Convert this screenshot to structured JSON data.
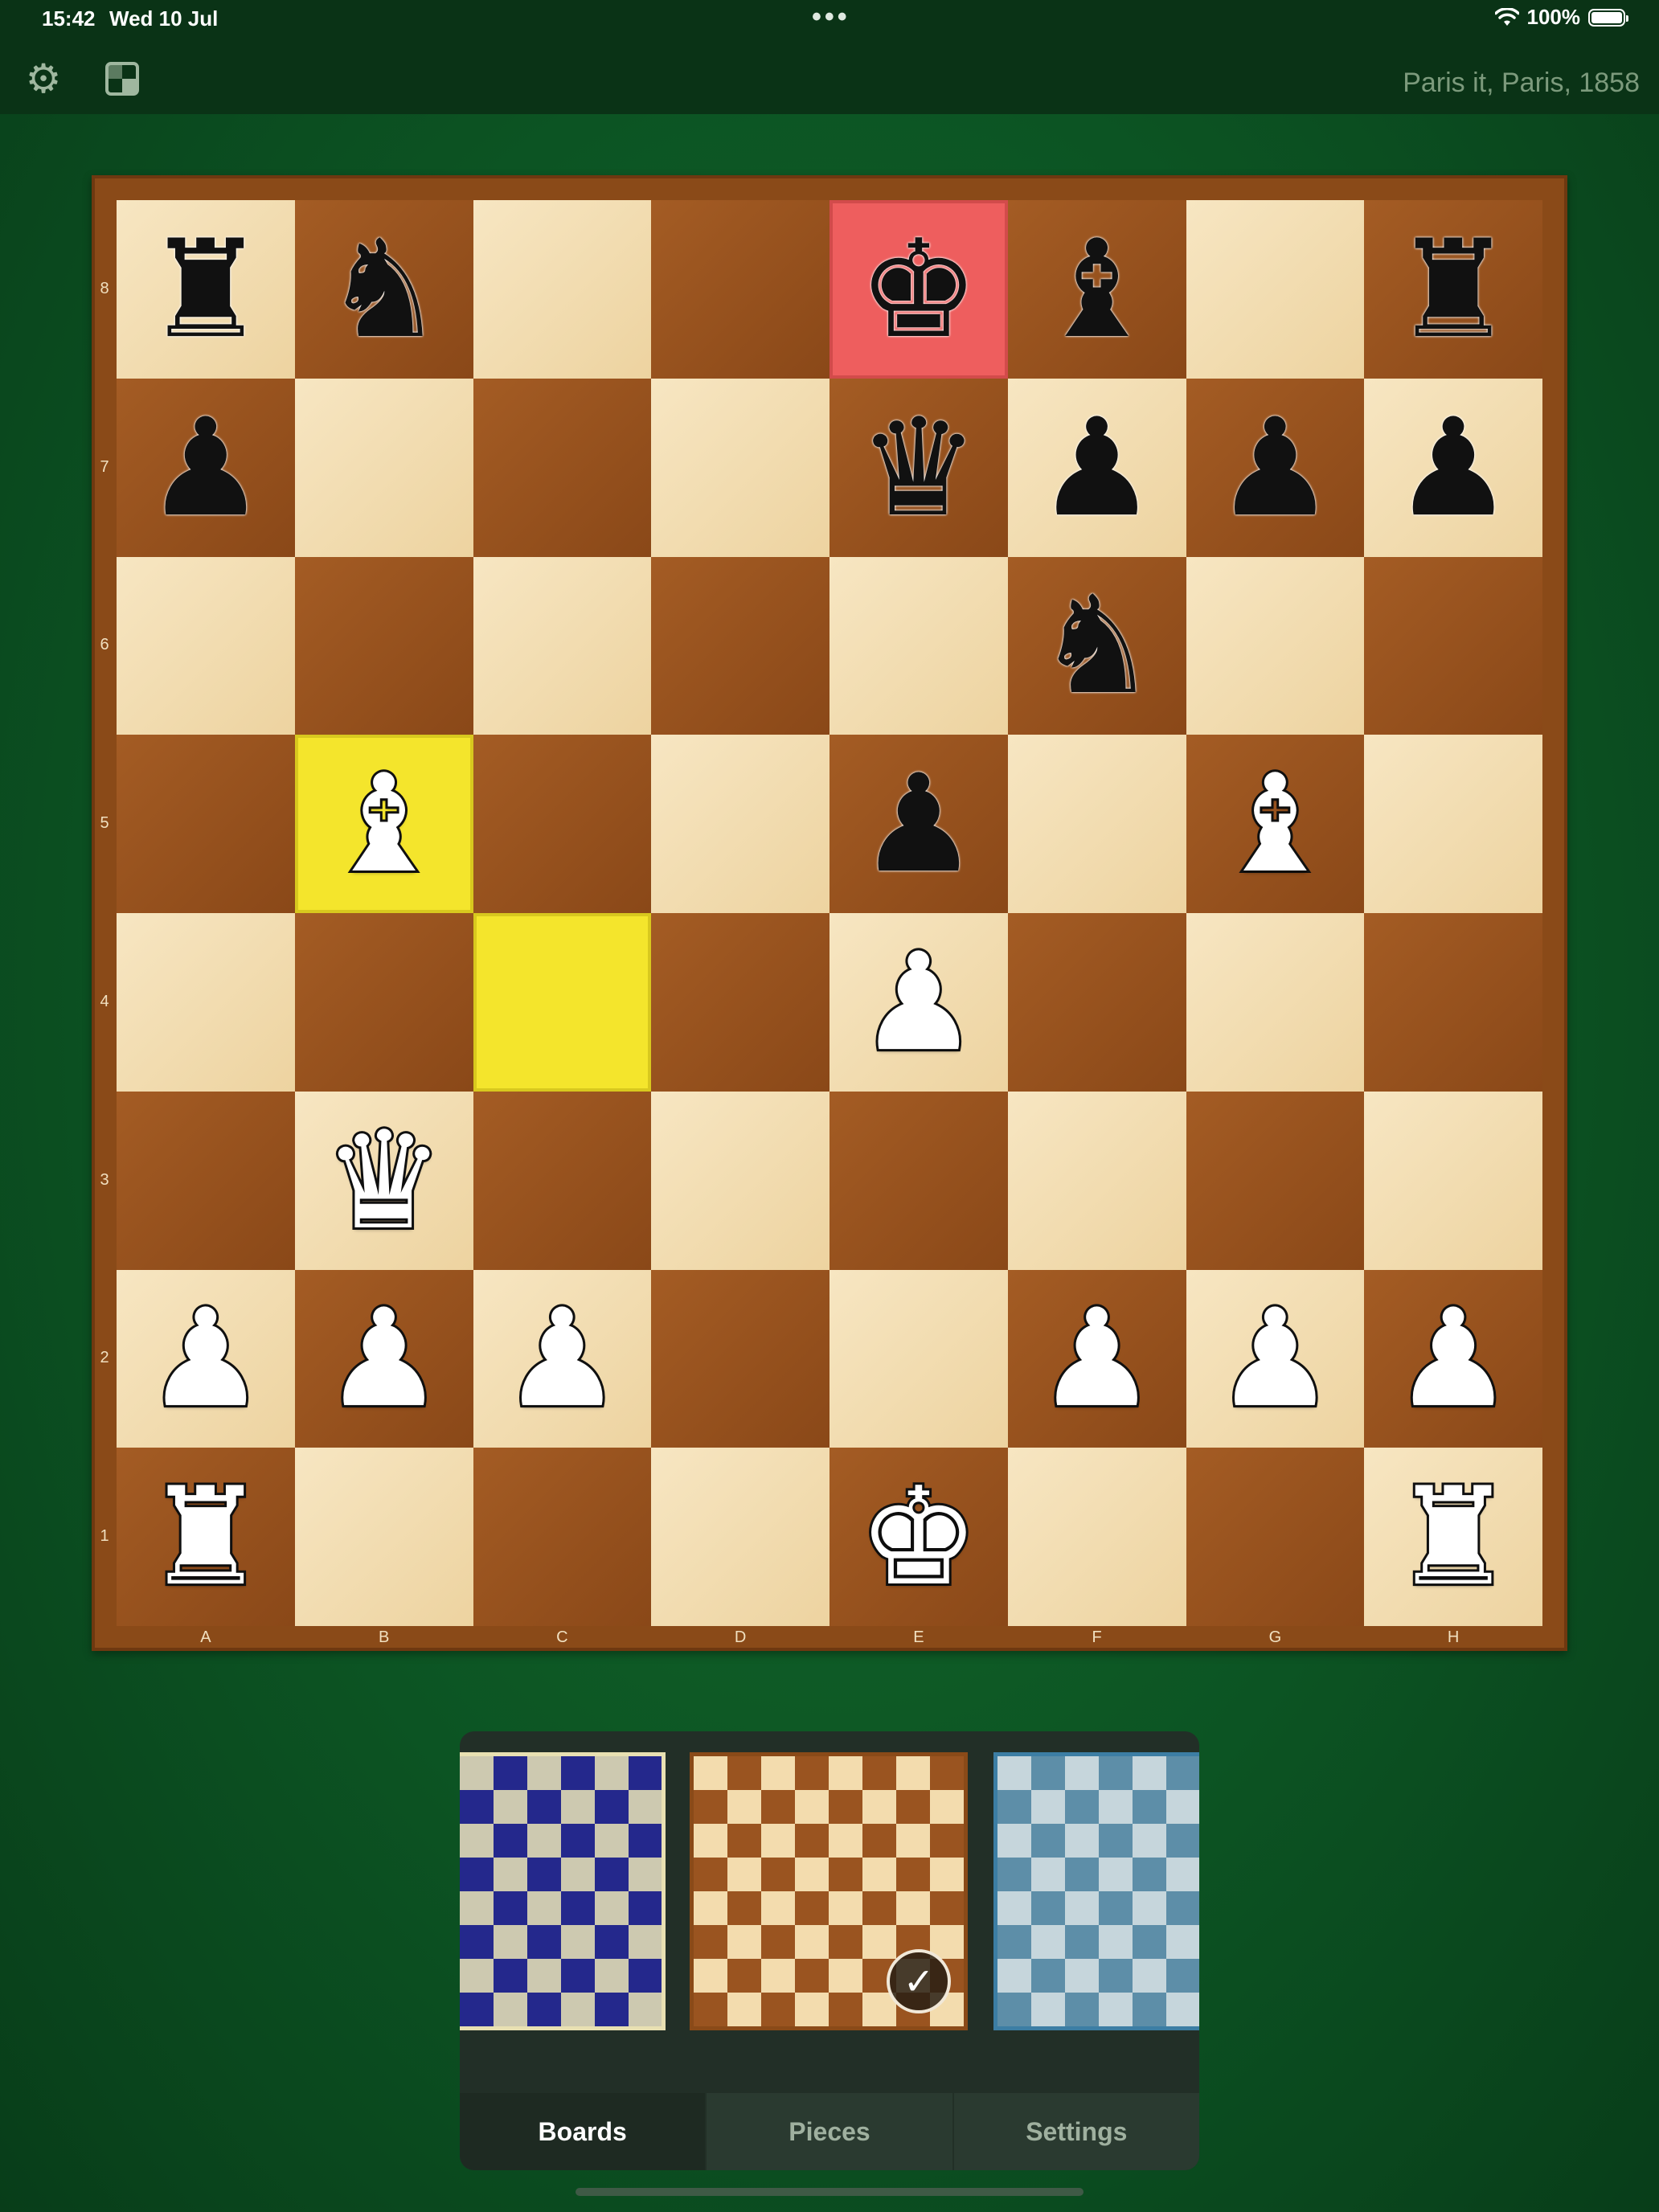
{
  "status_bar": {
    "time": "15:42",
    "date": "Wed 10 Jul",
    "multitask_dots": "•••",
    "wifi_icon": "wifi-icon",
    "battery": "100%"
  },
  "toolbar": {
    "settings_icon": "gear-icon",
    "board_icon": "board-layout-icon",
    "game_title": "Paris it, Paris, 1858"
  },
  "board": {
    "ranks": [
      "8",
      "7",
      "6",
      "5",
      "4",
      "3",
      "2",
      "1"
    ],
    "files": [
      "A",
      "B",
      "C",
      "D",
      "E",
      "F",
      "G",
      "H"
    ],
    "highlight_from": "c4",
    "highlight_to": "b5",
    "check_square": "e8",
    "position": {
      "a8": "♜",
      "b8": "♞",
      "e8": "♚",
      "f8": "♝",
      "h8": "♜",
      "a7": "♟",
      "e7": "♛",
      "f7": "♟",
      "g7": "♟",
      "h7": "♟",
      "f6": "♞",
      "b5": "♗",
      "e5": "♟",
      "g5": "♗",
      "e4": "♙",
      "b3": "♕",
      "a2": "♙",
      "b2": "♙",
      "c2": "♙",
      "f2": "♙",
      "g2": "♙",
      "h2": "♙",
      "a1": "♖",
      "e1": "♔",
      "h1": "♖"
    }
  },
  "panel": {
    "themes": [
      {
        "id": "blue",
        "light": "#cdc9b0",
        "dark": "#24288c",
        "selected": false
      },
      {
        "id": "wood",
        "light": "#f3dcae",
        "dark": "#9a5420",
        "selected": true
      },
      {
        "id": "ice",
        "light": "#c6d6dc",
        "dark": "#5d8ea8",
        "selected": false
      }
    ],
    "selected_mark": "✓",
    "tabs": [
      "Boards",
      "Pieces",
      "Settings"
    ],
    "active_tab": "Boards"
  }
}
